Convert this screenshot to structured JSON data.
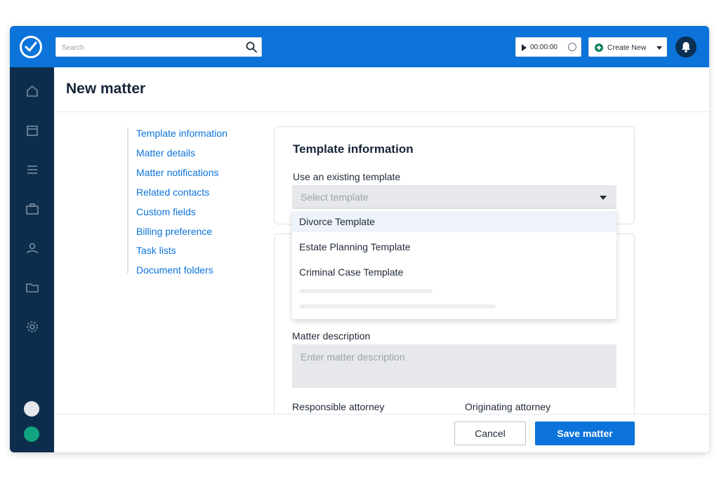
{
  "colors": {
    "brand": "#0b73d9",
    "sidebar": "#0d2d4d",
    "success": "#13805f",
    "avatar_teal": "#11a37f"
  },
  "search": {
    "placeholder": "Search"
  },
  "timer": {
    "value": "00:00:00"
  },
  "create": {
    "label": "Create New"
  },
  "header": {
    "title": "New matter"
  },
  "leftnav": {
    "items": [
      {
        "label": "Template information"
      },
      {
        "label": "Matter details"
      },
      {
        "label": "Matter notifications"
      },
      {
        "label": "Related contacts"
      },
      {
        "label": "Custom fields"
      },
      {
        "label": "Billing preference"
      },
      {
        "label": "Task lists"
      },
      {
        "label": "Document folders"
      }
    ]
  },
  "template_card": {
    "title": "Template information",
    "field_label": "Use an existing template",
    "select_placeholder": "Select template",
    "options": [
      {
        "label": "Divorce Template"
      },
      {
        "label": "Estate Planning Template"
      },
      {
        "label": "Criminal Case Template"
      }
    ]
  },
  "matter": {
    "description_label": "Matter description",
    "description_placeholder": "Enter matter description",
    "responsible_label": "Responsible attorney",
    "originating_label": "Originating attorney"
  },
  "footer": {
    "cancel_label": "Cancel",
    "save_label": "Save matter"
  },
  "icons": {
    "logo": "check-circle-icon",
    "search": "search-icon",
    "timer_play": "play-icon",
    "timer_clock": "clock-icon",
    "create": "plus-circle-icon",
    "notifications": "bell-icon",
    "sidebar": [
      "home-icon",
      "calendar-icon",
      "list-icon",
      "briefcase-icon",
      "person-icon",
      "folder-icon",
      "gear-icon"
    ]
  }
}
